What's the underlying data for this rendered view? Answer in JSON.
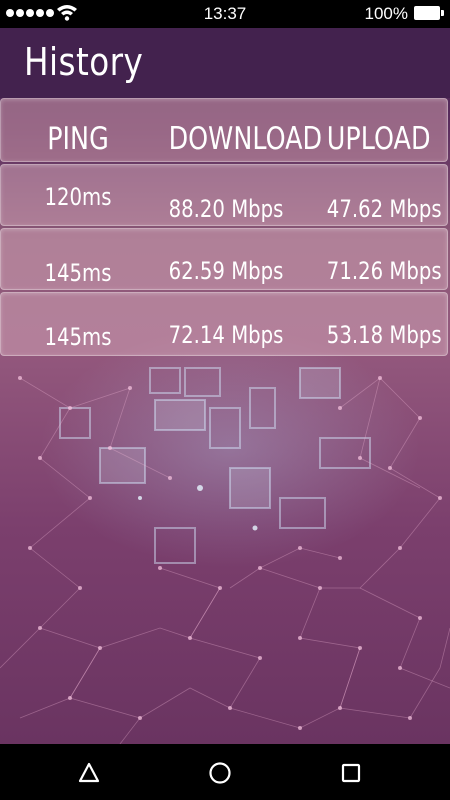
{
  "status_bar": {
    "time": "13:37",
    "battery_percent": "100%",
    "signal_bars": 5,
    "icons": [
      "signal-icon",
      "wifi-icon",
      "battery-icon"
    ]
  },
  "app_bar": {
    "title": "History"
  },
  "history": {
    "headers": {
      "ping": "PING",
      "download": "DOWNLOAD",
      "upload": "UPLOAD"
    },
    "rows": [
      {
        "ping": "120ms",
        "download": "88.20 Mbps",
        "upload": "47.62 Mbps"
      },
      {
        "ping": "145ms",
        "download": "62.59 Mbps",
        "upload": "71.26 Mbps"
      },
      {
        "ping": "145ms",
        "download": "72.14 Mbps",
        "upload": "53.18 Mbps"
      }
    ]
  },
  "nav_bar": {
    "icons": [
      "back-icon",
      "home-icon",
      "recent-apps-icon"
    ]
  },
  "colors": {
    "app_bar": "#43224e",
    "background_top": "#8d5a78",
    "background_bottom": "#6a3461",
    "text": "#ffffff"
  }
}
